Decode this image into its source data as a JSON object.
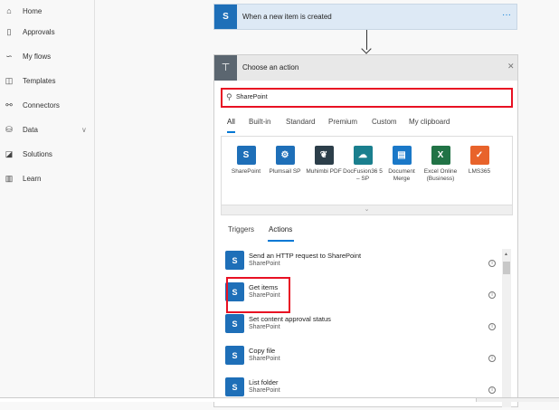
{
  "sidebar": {
    "items": [
      {
        "label": "Home",
        "icon": "home-icon",
        "glyph": "⌂"
      },
      {
        "label": "Approvals",
        "icon": "clipboard-icon",
        "glyph": "▯"
      },
      {
        "label": "My flows",
        "icon": "flow-icon",
        "glyph": "∽"
      },
      {
        "label": "Templates",
        "icon": "templates-icon",
        "glyph": "◫"
      },
      {
        "label": "Connectors",
        "icon": "connector-icon",
        "glyph": "⚯"
      },
      {
        "label": "Data",
        "icon": "database-icon",
        "glyph": "⛁",
        "chevron": "∨"
      },
      {
        "label": "Solutions",
        "icon": "solutions-icon",
        "glyph": "◪"
      },
      {
        "label": "Learn",
        "icon": "book-icon",
        "glyph": "▥"
      }
    ]
  },
  "trigger": {
    "title": "When a new item is created",
    "more": "···",
    "icon_text": "S"
  },
  "action": {
    "title": "Choose an action",
    "close": "✕",
    "search_value": "SharePoint",
    "filter_tabs": [
      "All",
      "Built-in",
      "Standard",
      "Premium",
      "Custom",
      "My clipboard"
    ],
    "connectors": [
      {
        "label": "SharePoint",
        "color": "#1e6fb8",
        "glyph": "S"
      },
      {
        "label": "Plumsail SP",
        "color": "#1e6fb8",
        "glyph": "⚙"
      },
      {
        "label": "Muhimbi PDF",
        "color": "#2c3e4a",
        "glyph": "❦"
      },
      {
        "label": "DocFusion36 5 – SP",
        "color": "#1a7f8e",
        "glyph": "☁"
      },
      {
        "label": "Document Merge",
        "color": "#1a78c8",
        "glyph": "▤"
      },
      {
        "label": "Excel Online (Business)",
        "color": "#217346",
        "glyph": "X"
      },
      {
        "label": "LMS365",
        "color": "#e8632b",
        "glyph": "✓"
      }
    ],
    "expand": "⌄",
    "sub_tabs": [
      "Triggers",
      "Actions"
    ],
    "items": [
      {
        "title": "Send an HTTP request to SharePoint",
        "subtitle": "SharePoint"
      },
      {
        "title": "Get items",
        "subtitle": "SharePoint"
      },
      {
        "title": "Set content approval status",
        "subtitle": "SharePoint"
      },
      {
        "title": "Copy file",
        "subtitle": "SharePoint"
      },
      {
        "title": "List folder",
        "subtitle": "SharePoint"
      }
    ],
    "info": "i"
  },
  "colors": {
    "accent": "#0078d4",
    "highlight": "#e81123",
    "sharepoint": "#1e6fb8"
  }
}
